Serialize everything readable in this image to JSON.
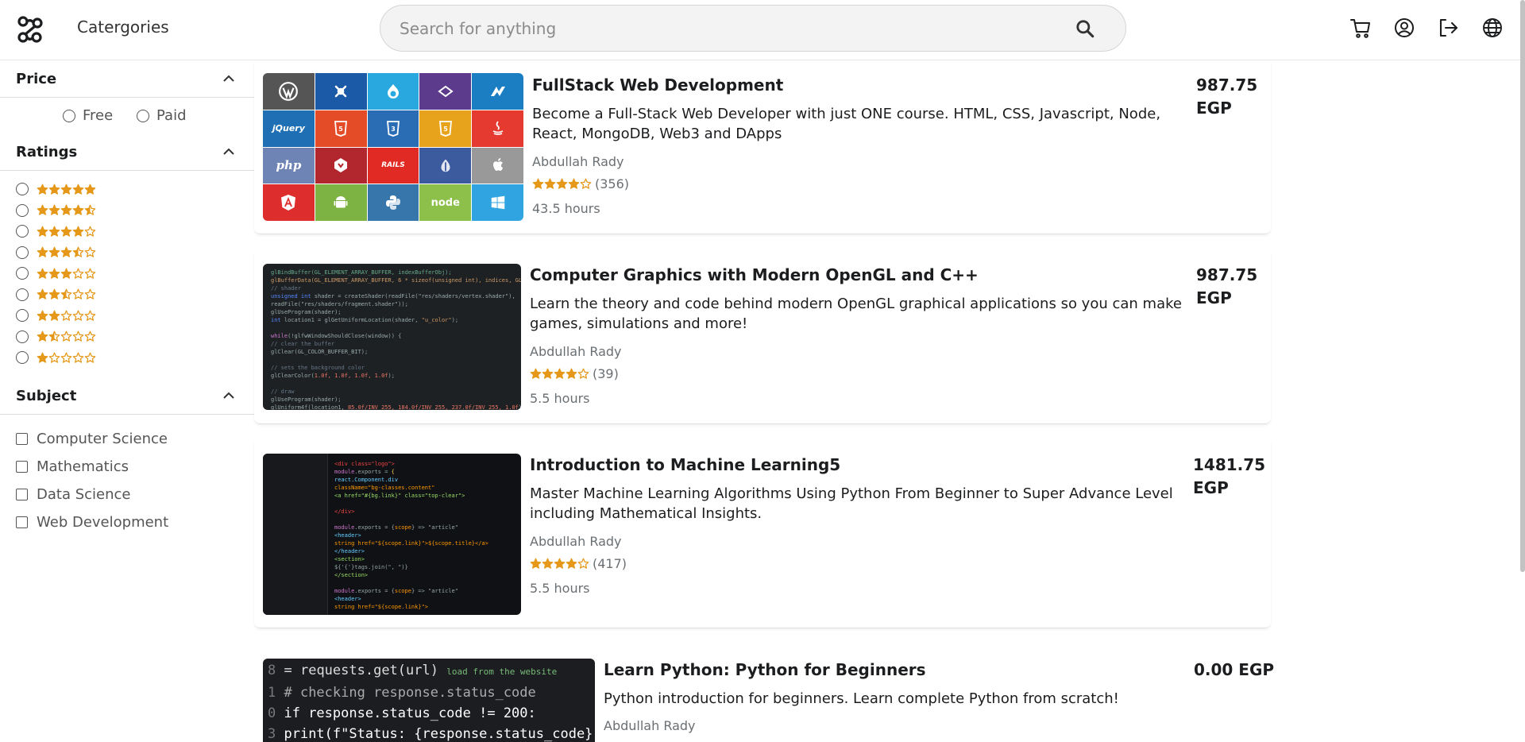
{
  "navbar": {
    "categories_label": "Catergories",
    "search_placeholder": "Search for anything"
  },
  "sidebar": {
    "price": {
      "title": "Price",
      "options": [
        "Free",
        "Paid"
      ]
    },
    "ratings": {
      "title": "Ratings",
      "levels": [
        5,
        4.5,
        4,
        3.5,
        3,
        2.5,
        2,
        1.5,
        1
      ]
    },
    "subject": {
      "title": "Subject",
      "options": [
        "Computer Science",
        "Mathematics",
        "Data Science",
        "Web Development"
      ]
    }
  },
  "courses": [
    {
      "title": "FullStack Web Development",
      "description": "Become a Full-Stack Web Developer with just ONE course. HTML, CSS, Javascript, Node, React, MongoDB, Web3 and DApps",
      "author": "Abdullah Rady",
      "rating": 4,
      "rating_count": "(356)",
      "hours": "43.5 hours",
      "price_value": "987.75",
      "price_currency": "EGP"
    },
    {
      "title": "Computer Graphics with Modern OpenGL and C++",
      "description": "Learn the theory and code behind modern OpenGL graphical applications so you can make games, simulations and more!",
      "author": "Abdullah Rady",
      "rating": 4,
      "rating_count": "(39)",
      "hours": "5.5 hours",
      "price_value": "987.75",
      "price_currency": "EGP"
    },
    {
      "title": "Introduction to Machine Learning5",
      "description": "Master Machine Learning Algorithms Using Python From Beginner to Super Advance Level including Mathematical Insights.",
      "author": "Abdullah Rady",
      "rating": 4,
      "rating_count": "(417)",
      "hours": "5.5 hours",
      "price_value": "1481.75",
      "price_currency": "EGP"
    },
    {
      "title": "Learn Python: Python for Beginners",
      "description": "Python introduction for beginners. Learn complete Python from scratch!",
      "author": "Abdullah Rady",
      "price": "0.00 EGP"
    }
  ],
  "thumbnail_tiles": [
    "WP",
    "Joomla",
    "Drupal",
    "Sass",
    "AngularJS",
    "jQuery",
    "HTML5",
    "CSS3",
    "JS",
    "Java",
    "php",
    "Laravel",
    "RAILS",
    "Onion",
    "Apple",
    "Angular",
    "Android",
    "Python",
    "node",
    "Windows"
  ],
  "thumbnail_text": {
    "tile_php": "php",
    "tile_rails": "RAILS",
    "tile_node": "node",
    "tile_jquery": "jQuery",
    "code_python": [
      "requests.get(url)",
      "# checking response.status_code",
      "if response.status_code != 200:",
      "print(f\"Status: {response.status_code}\")"
    ]
  },
  "colors": {
    "star": "#e59819",
    "tiles": [
      "#555555",
      "#1a5aa6",
      "#29a8e0",
      "#5c3a8c",
      "#1c7ec2",
      "#1f6fb4",
      "#e34c26",
      "#2a6db5",
      "#e8a31c",
      "#e43a2f",
      "#6d84b5",
      "#b2272d",
      "#e12a23",
      "#3c5b9f",
      "#999999",
      "#dd2d2d",
      "#7cb342",
      "#3776ab",
      "#8cc04b",
      "#2fa4e0"
    ]
  }
}
